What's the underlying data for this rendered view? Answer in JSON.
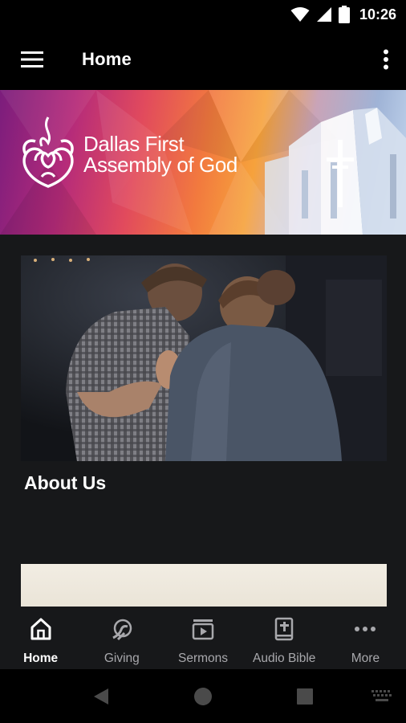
{
  "status_bar": {
    "time": "10:26",
    "icons": [
      "wifi-icon",
      "signal-icon",
      "battery-icon"
    ]
  },
  "app_bar": {
    "title": "Home",
    "menu_icon": "hamburger-menu-icon",
    "overflow_icon": "more-vert-icon"
  },
  "banner": {
    "org_name_line1": "Dallas First",
    "org_name_line2": "Assembly of God",
    "logo_icon": "church-flame-logo"
  },
  "content": {
    "card_title": "About Us"
  },
  "bottom_nav": {
    "items": [
      {
        "label": "Home",
        "icon": "home-icon",
        "active": true
      },
      {
        "label": "Giving",
        "icon": "giving-icon",
        "active": false
      },
      {
        "label": "Sermons",
        "icon": "video-play-icon",
        "active": false
      },
      {
        "label": "Audio Bible",
        "icon": "bible-icon",
        "active": false
      },
      {
        "label": "More",
        "icon": "more-horiz-icon",
        "active": false
      }
    ]
  },
  "system_nav": {
    "icons": [
      "back-icon",
      "home-circle-icon",
      "recents-icon",
      "keyboard-icon"
    ]
  },
  "colors": {
    "app_bar": "#000000",
    "content_bg": "#17181a",
    "nav_inactive": "#a8a8ac",
    "nav_active": "#ffffff"
  }
}
